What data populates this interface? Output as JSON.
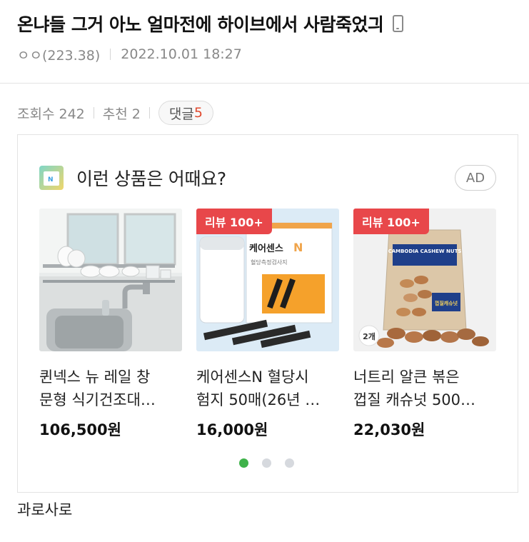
{
  "post": {
    "title": "온냐들 그거 아노 얼마전에 하이브에서 사람죽었긔",
    "author": "ㅇㅇ(223.38)",
    "date": "2022.10.01 18:27"
  },
  "stats": {
    "views_label": "조회수 242",
    "recommend_label": "추천 2",
    "comments_label": "댓글",
    "comments_count": "5"
  },
  "ad": {
    "title": "이런 상품은 어때요?",
    "badge": "AD",
    "products": [
      {
        "name_line1": "퀸넥스 뉴 레일 창",
        "name_line2": "문형 식기건조대…",
        "price": "106,500원",
        "review_tag": ""
      },
      {
        "name_line1": "케어센스N 혈당시",
        "name_line2": "험지 50매(26년 …",
        "price": "16,000원",
        "review_tag": "리뷰 100+"
      },
      {
        "name_line1": "너트리 알큰 볶은",
        "name_line2": "껍질 캐슈넛 500…",
        "price": "22,030원",
        "review_tag": "리뷰 100+"
      }
    ],
    "product_images": {
      "p2_brand": "케어센스",
      "p2_brand_n": "N",
      "p2_sub": "혈당측정검사지",
      "p3_bag_title": "CAMBODIA CASHEW NUTS",
      "p3_bag_label": "껍질캐슈넛",
      "p3_count": "2개"
    },
    "pager": {
      "count": 3,
      "active": 1
    }
  },
  "comment": {
    "text": "과로사로"
  },
  "colors": {
    "review_tag": "#e8474a",
    "dot_active": "#3fb24a",
    "dot_inactive": "#d6d9de",
    "comment_count": "#e04a2f"
  }
}
